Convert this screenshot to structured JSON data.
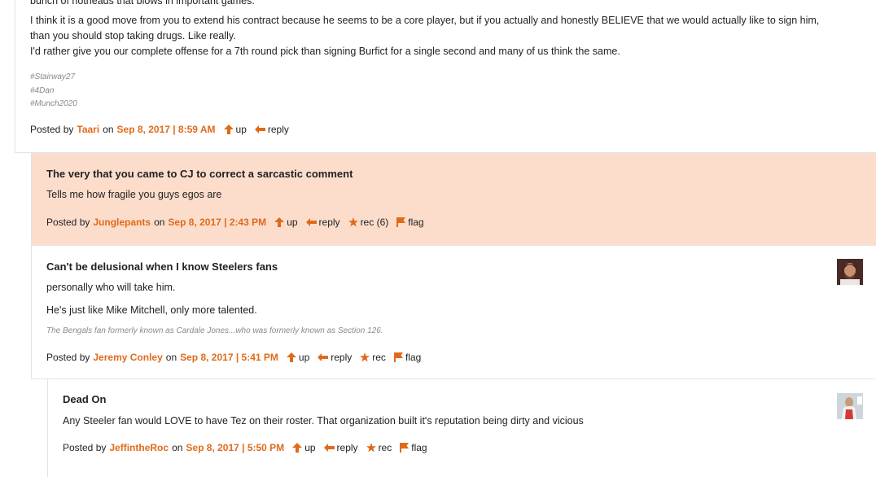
{
  "comments": [
    {
      "body": [
        "bunch of hotheads that blows in important games.",
        "I think it is a good move from you to extend his contract because he seems to be a core player, but if you actually and honestly BELIEVE that we would actually like to sign him,",
        "than you should stop taking drugs. Like really.",
        "I'd rather give you our complete offense for a 7th round pick than signing Burfict for a single second and many of us think the same."
      ],
      "tags": [
        "#Stairway27",
        "#4Dan",
        "#Munch2020"
      ],
      "posted_by": "Posted by",
      "author": "Taari",
      "on": "on",
      "date": "Sep 8, 2017 | 8:59 AM",
      "up": "up",
      "reply": "reply"
    },
    {
      "title": "The very that you came to CJ to correct a sarcastic comment",
      "body": [
        "Tells me how fragile you guys egos are"
      ],
      "posted_by": "Posted by",
      "author": "Junglepants",
      "on": "on",
      "date": "Sep 8, 2017 | 2:43 PM",
      "up": "up",
      "reply": "reply",
      "rec": "rec (6)",
      "flag": "flag"
    },
    {
      "title": "Can't be delusional when I know Steelers fans",
      "body": [
        "personally who will take him.",
        "He's just like Mike Mitchell, only more talented."
      ],
      "signature": "The Bengals fan formerly known as Cardale Jones...who was formerly known as Section 126.",
      "posted_by": "Posted by",
      "author": "Jeremy Conley",
      "on": "on",
      "date": "Sep 8, 2017 | 5:41 PM",
      "up": "up",
      "reply": "reply",
      "rec": "rec",
      "flag": "flag"
    },
    {
      "title": "Dead On",
      "body": [
        "Any Steeler fan would LOVE to have Tez on their roster. That organization built it's reputation being dirty and vicious"
      ],
      "posted_by": "Posted by",
      "author": "JeffintheRoc",
      "on": "on",
      "date": "Sep 8, 2017 | 5:50 PM",
      "up": "up",
      "reply": "reply",
      "rec": "rec",
      "flag": "flag"
    }
  ],
  "colors": {
    "accent": "#e06a1a",
    "highlight_bg": "#fcddcc"
  }
}
